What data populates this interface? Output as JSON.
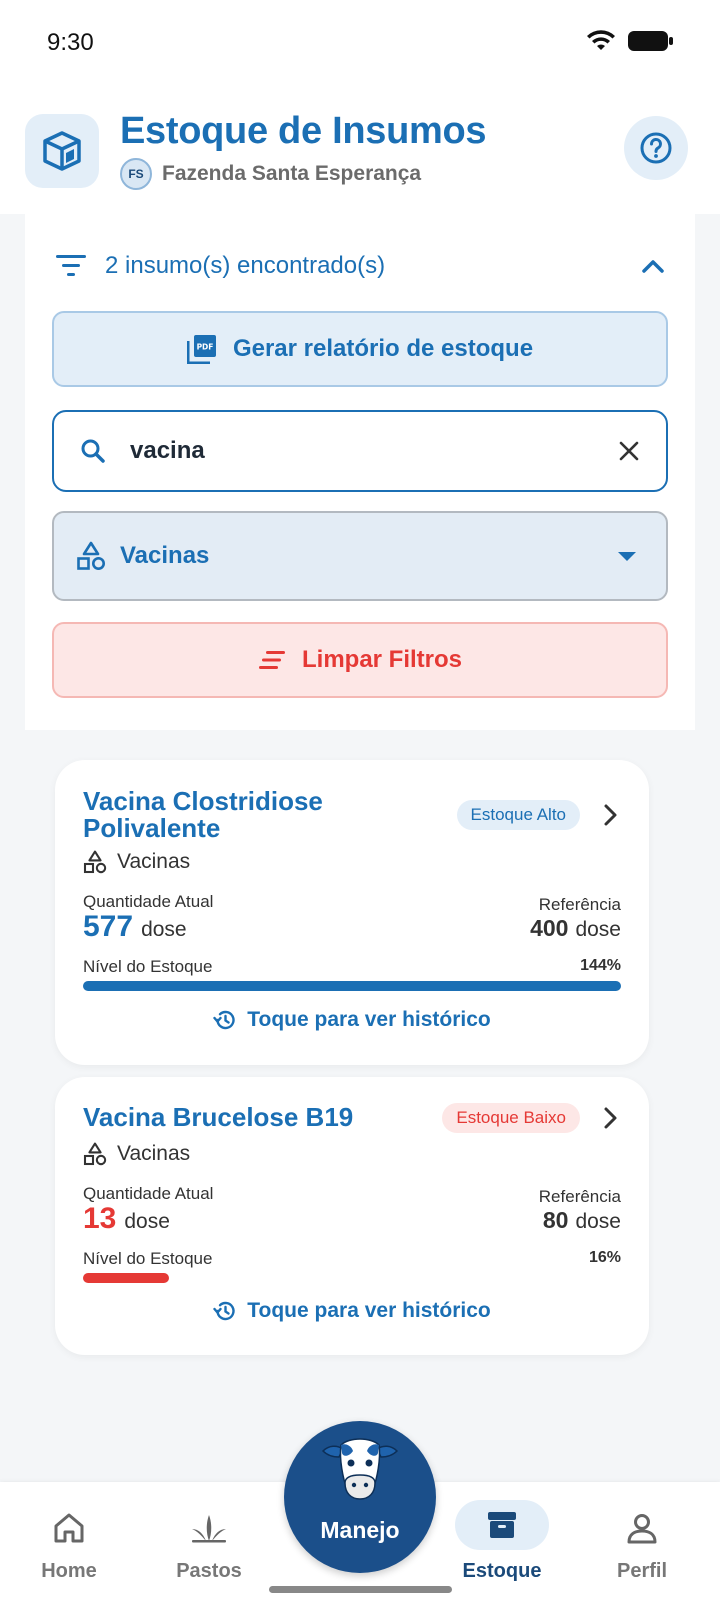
{
  "status_bar": {
    "time": "9:30"
  },
  "header": {
    "title": "Estoque de Insumos",
    "farm_initials": "FS",
    "farm_name": "Fazenda Santa Esperança"
  },
  "filters": {
    "summary": "2 insumo(s) encontrado(s)",
    "report_button": "Gerar relatório de estoque",
    "search_value": "vacina",
    "category_selected": "Vacinas",
    "clear_button": "Limpar Filtros"
  },
  "items": [
    {
      "title_line1": "Vacina Clostridiose",
      "title_line2": "Polivalente",
      "badge": "Estoque Alto",
      "category": "Vacinas",
      "qty_label": "Quantidade Atual",
      "qty": "577",
      "unit": "dose",
      "ref_label": "Referência",
      "ref": "400",
      "ref_unit": "dose",
      "level_label": "Nível do Estoque",
      "level_pct": "144%",
      "level_fraction": 1.0,
      "history": "Toque para ver histórico"
    },
    {
      "title_line1": "Vacina Brucelose B19",
      "badge": "Estoque Baixo",
      "category": "Vacinas",
      "qty_label": "Quantidade Atual",
      "qty": "13",
      "unit": "dose",
      "ref_label": "Referência",
      "ref": "80",
      "ref_unit": "dose",
      "level_label": "Nível do Estoque",
      "level_pct": "16%",
      "level_fraction": 0.16,
      "history": "Toque para ver histórico"
    }
  ],
  "nav": {
    "home": "Home",
    "pastos": "Pastos",
    "manejo": "Manejo",
    "estoque": "Estoque",
    "perfil": "Perfil"
  },
  "colors": {
    "primary": "#1b6fb4",
    "danger": "#e53935",
    "nav_dark": "#1b4f8a"
  }
}
